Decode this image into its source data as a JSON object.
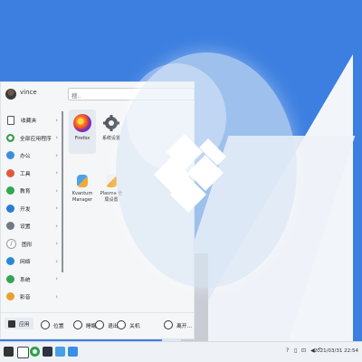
{
  "menu": {
    "username": "vince",
    "search_placeholder": "搜..",
    "categories": [
      {
        "label": "收藏夹",
        "icon": "bookmark-icon"
      },
      {
        "label": "全部应用程序",
        "icon": "apps-icon"
      },
      {
        "label": "办公",
        "icon": "office-icon"
      },
      {
        "label": "工具",
        "icon": "tools-icon"
      },
      {
        "label": "教育",
        "icon": "education-icon"
      },
      {
        "label": "开发",
        "icon": "development-icon"
      },
      {
        "label": "设置",
        "icon": "settings-icon"
      },
      {
        "label": "图形",
        "icon": "graphics-icon"
      },
      {
        "label": "网络",
        "icon": "network-icon"
      },
      {
        "label": "系统",
        "icon": "system-icon"
      },
      {
        "label": "影音",
        "icon": "multimedia-icon"
      }
    ],
    "apps": [
      {
        "label": "Firefox",
        "icon": "firefox-icon"
      },
      {
        "label": "系统设置",
        "icon": "system-settings-icon"
      },
      {
        "label": "Kvantum Manager",
        "label1": "Kvantum",
        "label2": "Manager",
        "icon": "kvantum-icon"
      },
      {
        "label": "Plasma 全局设置",
        "label1": "Plasma 全",
        "label2": "局设置",
        "icon": "plasma-icon"
      }
    ],
    "bottom": {
      "apps": "应用",
      "places": "位置",
      "sleep": "睡眠",
      "logout": "退出",
      "shutdown": "关机",
      "more": "离开..."
    }
  },
  "taskbar": {
    "clock": "2021/03/31 22:54"
  },
  "colors": {
    "wallpaper": "#3c7fe0",
    "menu_bg": "#f4f6f8"
  }
}
